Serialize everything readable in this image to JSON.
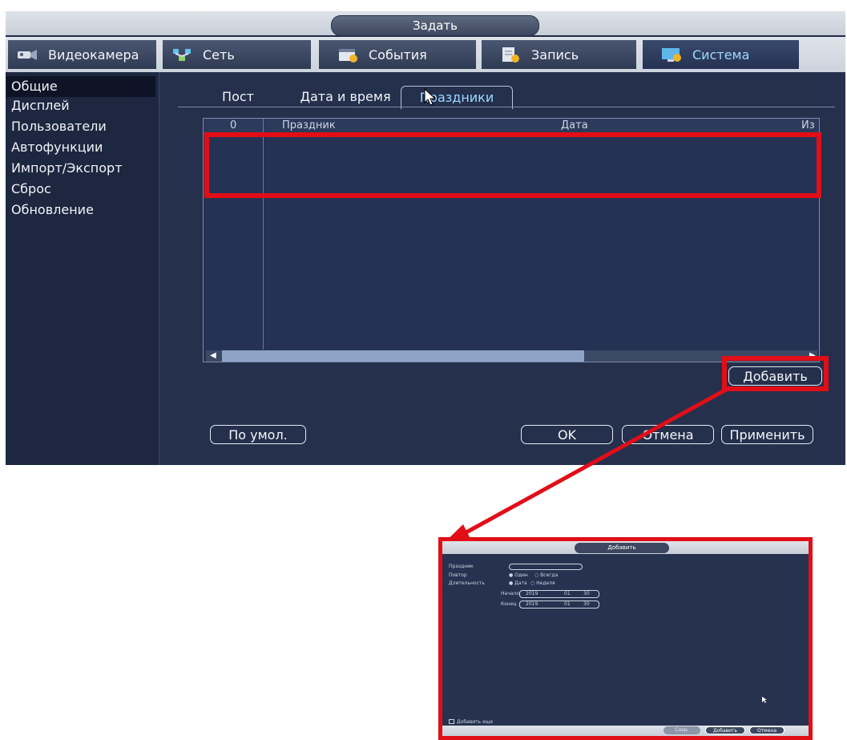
{
  "window": {
    "title": "Задать"
  },
  "nav": {
    "tabs": [
      {
        "label": "Видеокамера",
        "icon": "camera-icon"
      },
      {
        "label": "Сеть",
        "icon": "network-icon"
      },
      {
        "label": "События",
        "icon": "events-icon"
      },
      {
        "label": "Запись",
        "icon": "record-icon"
      },
      {
        "label": "Система",
        "icon": "system-icon",
        "active": true
      }
    ]
  },
  "sidebar": {
    "items": [
      {
        "label": "Общие",
        "active": true
      },
      {
        "label": "Дисплей"
      },
      {
        "label": "Пользователи"
      },
      {
        "label": "Автофункции"
      },
      {
        "label": "Импорт/Экспорт"
      },
      {
        "label": "Сброс"
      },
      {
        "label": "Обновление"
      }
    ]
  },
  "subtabs": [
    {
      "label": "Пост"
    },
    {
      "label": "Дата и время"
    },
    {
      "label": "Праздники",
      "active": true
    }
  ],
  "table": {
    "columns": [
      "0",
      "Праздник",
      "Дата",
      "Из"
    ]
  },
  "buttons": {
    "add": "Добавить",
    "default": "По умол.",
    "ok": "OK",
    "cancel": "Отмена",
    "apply": "Применить"
  },
  "dialog": {
    "title": "Добавить",
    "holiday_label": "Праздник",
    "repeat_label": "Повтор",
    "repeat_once": "Один",
    "repeat_always": "Всегда",
    "duration_label": "Длительность",
    "duration_date": "Дата",
    "duration_week": "Неделя",
    "start_label": "Начало",
    "start_year": "2019",
    "start_month": "01",
    "start_day": "30",
    "end_label": "Конец",
    "end_year": "2019",
    "end_month": "01",
    "end_day": "30",
    "add_more_label": "Добавить еще",
    "save_label": "Сохр.",
    "add_label": "Добавить",
    "cancel_label": "Отмена"
  },
  "colors": {
    "annotation": "#e10e18",
    "accent": "#9cd9ff",
    "panel": "#24304c"
  }
}
